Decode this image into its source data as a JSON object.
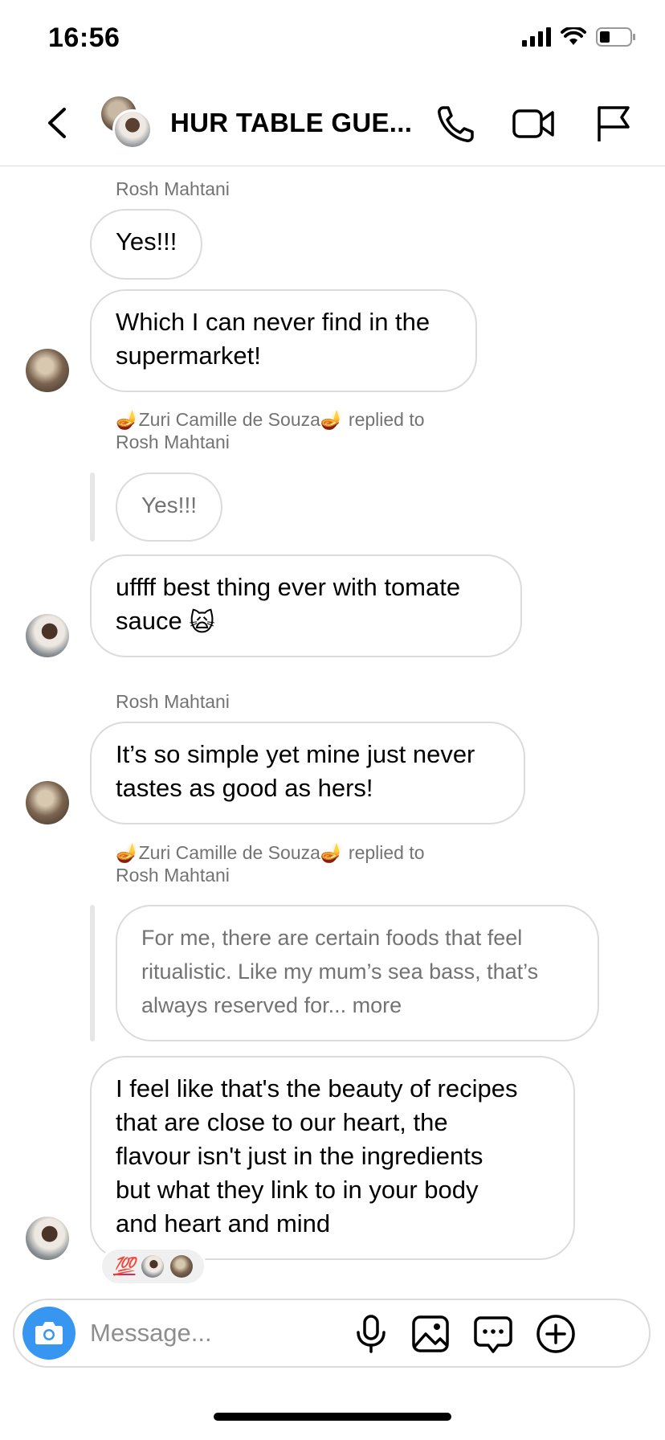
{
  "status_bar": {
    "time": "16:56"
  },
  "header": {
    "title": "HUR TABLE GUE..."
  },
  "messages": [
    {
      "sender": "Rosh Mahtani",
      "text": "Yes!!!"
    },
    {
      "text": "Which I can never find in the supermarket!",
      "line1": "Which I can never find in the",
      "line2": "supermarket!"
    },
    {
      "reply_label_line1": "🪔Zuri Camille de Souza🪔 replied to",
      "reply_label_line2": "Rosh Mahtani",
      "quote": "Yes!!!"
    },
    {
      "line1": "uffff best thing ever with tomate",
      "line2": "sauce",
      "emoji": "🙀"
    },
    {
      "sender": "Rosh Mahtani",
      "line1": "It’s so simple yet mine just never",
      "line2": "tastes as good as hers!"
    },
    {
      "reply_label_line1": "🪔Zuri Camille de Souza🪔 replied to",
      "reply_label_line2": "Rosh Mahtani",
      "quote_line1": "For me, there are certain foods that feel",
      "quote_line2": "ritualistic. Like my mum’s sea bass, that’s",
      "quote_line3": "always reserved for... more"
    },
    {
      "line1": "I feel like that's the beauty of recipes",
      "line2": "that are close to our heart, the",
      "line3": "flavour isn't just in the ingredients",
      "line4": "but what they link to in your body",
      "line5": "and heart and mind",
      "reaction": "💯"
    }
  ],
  "composer": {
    "placeholder": "Message..."
  },
  "icons": {
    "back": "chevron-left-icon",
    "call": "phone-icon",
    "video": "video-camera-icon",
    "report": "flag-icon",
    "camera": "camera-icon",
    "mic": "microphone-icon",
    "gallery": "image-icon",
    "sticker": "chat-bubble-icon",
    "more": "plus-circle-icon"
  },
  "colors": {
    "accent": "#3797f0",
    "border": "#dbdbdb",
    "muted": "#737373"
  }
}
